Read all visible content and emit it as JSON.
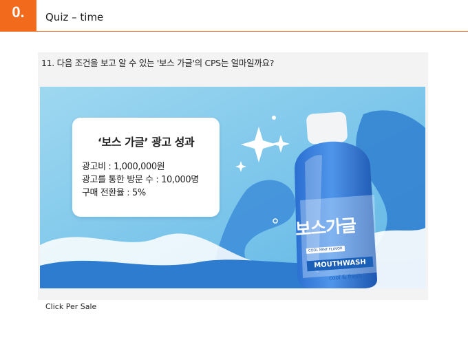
{
  "header": {
    "number": "0.",
    "title": "Quiz – time",
    "accent_color": "#f26a1b"
  },
  "question": {
    "text": "11. 다음 조건을 보고 알 수 있는 '보스 가글'의 CPS는 얼마일까요?"
  },
  "ad": {
    "info_title": "‘보스 가글’ 광고 성과",
    "lines": [
      "광고비 : 1,000,000원",
      "광고를 통한 방문 수 : 10,000명",
      "구매 전환율 : 5%"
    ],
    "bottle": {
      "brand": "보스가글",
      "flavor": "COOL MINT FLAVOR",
      "product": "MOUTHWASH",
      "tagline": "cool & fresh"
    }
  },
  "caption": {
    "text": "Click Per Sale"
  }
}
